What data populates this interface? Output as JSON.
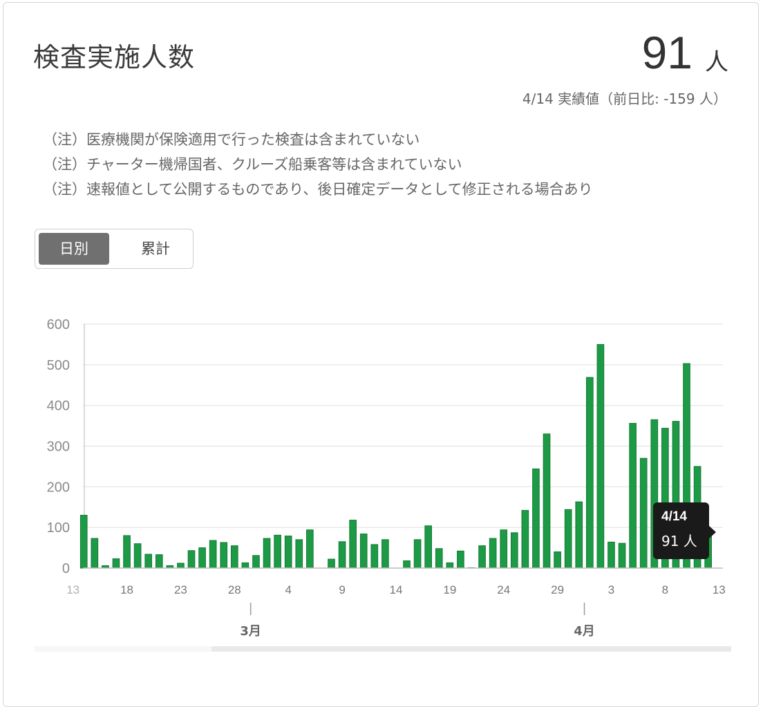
{
  "header": {
    "title": "検査実施人数",
    "value": "91",
    "unit": "人",
    "subline": "4/14 実績値（前日比: -159 人）"
  },
  "notes": [
    "（注）医療機関が保険適用で行った検査は含まれていない",
    "（注）チャーター機帰国者、クルーズ船乗客等は含まれていない",
    "（注）速報値として公開するものであり、後日確定データとして修正される場合あり"
  ],
  "toggle": {
    "daily": "日別",
    "cumulative": "累計",
    "active": "daily"
  },
  "tooltip": {
    "date": "4/14",
    "value": "91 人"
  },
  "colors": {
    "bar": "#1d9a45",
    "bar_edge": "#157a36",
    "grid": "#e3e3e3",
    "axis": "#aaaaaa"
  },
  "chart_data": {
    "type": "bar",
    "ylim": [
      0,
      600
    ],
    "yticks": [
      "0",
      "100",
      "200",
      "300",
      "400",
      "500",
      "600"
    ],
    "grid": true,
    "x_start": "2020-02-13",
    "x_tick_labels": [
      "13",
      "18",
      "23",
      "28",
      "4",
      "9",
      "14",
      "19",
      "24",
      "29",
      "3",
      "8",
      "13"
    ],
    "month_labels": [
      "3月",
      "4月"
    ],
    "values": [
      0,
      130,
      73,
      6,
      23,
      80,
      60,
      34,
      33,
      6,
      12,
      43,
      50,
      68,
      63,
      55,
      13,
      31,
      73,
      81,
      79,
      70,
      94,
      0,
      22,
      65,
      118,
      84,
      58,
      70,
      0,
      18,
      70,
      104,
      48,
      13,
      42,
      1,
      55,
      73,
      94,
      87,
      142,
      244,
      330,
      40,
      144,
      163,
      469,
      550,
      64,
      61,
      356,
      270,
      365,
      344,
      361,
      503,
      250,
      91
    ]
  }
}
